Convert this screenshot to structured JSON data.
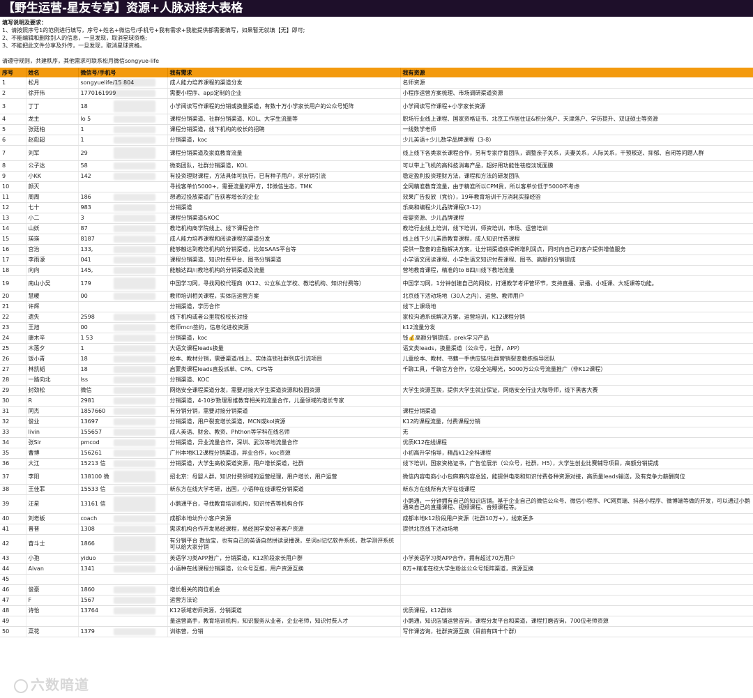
{
  "title": "【野生运营-星友专享】资源+人脉对接大表格",
  "notes": {
    "heading": "填写说明及要求：",
    "lines": [
      "1、请按照序号1的范例进行填写，序号+姓名+微信号/手机号+我有需求+我能提供都需要填写，如果暂无就填【无】即可;",
      "2、不能编辑和删除别人的信息，一旦发现，取消星球资格;",
      "3、不能把此文件分享及外传，一旦发现，取消星球资格。"
    ],
    "footer": "请遵守规则，共建秩序，其他需求可联系松月微信songyue-life"
  },
  "columns": [
    "序号",
    "姓名",
    "微信号/手机号",
    "我有需求",
    "我有资源"
  ],
  "rows": [
    {
      "no": "1",
      "name": "松月",
      "wx": "songyuelife/15 804",
      "need": "成人能力培养课程的渠道分发",
      "have": "名师资源",
      "h": 15
    },
    {
      "no": "2",
      "name": "徐开伟",
      "wx": "1770161999",
      "need": "需要小程序、app定制的企业",
      "have": "小程序运营方案梳理、市场调研渠道资源",
      "h": 15
    },
    {
      "no": "3",
      "name": "丁丁",
      "wx": "18",
      "need": "小学阅读写作课程的分销或换量渠道，有数十万小学家长用户的公众号矩阵",
      "have": "小学阅读写作课程+小学家长资源",
      "h": 22
    },
    {
      "no": "4",
      "name": "龙主",
      "wx": "lo 5",
      "need": "课程分销渠道、社群分销渠道、KOL、大学生流量等",
      "have": "职场行业线上课程、国家资格证书、北京工作居住证&积分落户、天津落户、学历提升、双证硕士等资源",
      "h": 15
    },
    {
      "no": "5",
      "name": "张廷柏",
      "wx": "1",
      "need": "课程分销渠道，线下机构的校长的招聘",
      "have": "一线数学老师",
      "h": 15
    },
    {
      "no": "6",
      "name": "赵彪超",
      "wx": "1",
      "need": "分销渠道，koc",
      "have": "少儿英语+少儿数学品牌课程（3-8）",
      "h": 15
    },
    {
      "no": "7",
      "name": "刘军",
      "wx": "29",
      "need": "课程分销渠道及家庭教育流量",
      "have": "线上线下各类家长课程合作，另有专家疗育团队，调整亲子关系，夫妻关系，人际关系，干预叛逆、抑郁、自闭等问题人群",
      "h": 22
    },
    {
      "no": "8",
      "name": "公子达",
      "wx": "58",
      "need": "微商团队，社群分销渠道，KOL",
      "have": "可以带上飞机的高科技消毒产品，超好用功能性祛痘淡斑面膜",
      "h": 15
    },
    {
      "no": "9",
      "name": "小KK",
      "wx": "142",
      "need": "有投资理财课程，方法具体可执行，已有种子用户，求分销引流",
      "have": "稳定盈利投资理财方法，课程和方法的研发团队",
      "h": 15
    },
    {
      "no": "10",
      "name": "颜灭",
      "wx": "",
      "need": "寻找客单价5000+，需要流量的甲方，非微信生态，TMK",
      "have": "全网精准教育流量，由于精准所以CPM贵，所以客单价低于5000不考虑",
      "h": 15
    },
    {
      "no": "11",
      "name": "周周",
      "wx": "186",
      "need": "想通过投放渠道广告获客增长的企业",
      "have": "效果广告投放（竞价），19年教育培训千万消耗实操经验",
      "h": 15
    },
    {
      "no": "12",
      "name": "七十",
      "wx": "983",
      "need": "分销渠道",
      "have": "乐高和编程少儿品牌课程(3-12)",
      "h": 15
    },
    {
      "no": "13",
      "name": "小二",
      "wx": "3",
      "need": "课程分销渠道&KOC",
      "have": "母婴资源、少儿品牌课程",
      "h": 15
    },
    {
      "no": "14",
      "name": "山妖",
      "wx": "87",
      "need": "教培机构商学院线上、线下课程合作",
      "have": "教培行业线上培训，线下培训，师资培训，市场、运营培训",
      "h": 15
    },
    {
      "no": "15",
      "name": "瑛瑛",
      "wx": "8187",
      "need": "成人能力培养课程和阅读课程的渠道分发",
      "have": "线上线下少儿素质教育课程，成人知识付费课程",
      "h": 15
    },
    {
      "no": "16",
      "name": "宫治",
      "wx": "133,",
      "need": "能够触达到教培机构的分销渠道，比如SAAS平台等",
      "have": "提供一整套的金融解决方案，让分销渠道获得新增利润点，同时向自己的客户提供增值服务",
      "h": 15
    },
    {
      "no": "17",
      "name": "李雨濛",
      "wx": "041",
      "need": "课程分销渠道、知识付费平台、图书分销渠道",
      "have": "小学语文阅读课程、小学生语文知识付费课程、图书、高额的分销提成",
      "h": 15
    },
    {
      "no": "18",
      "name": "向向",
      "wx": "145,",
      "need": "能触达四川教培机构的分销渠道及流量",
      "have": "营地教育课程，精准的to B四川线下教培流量",
      "h": 15
    },
    {
      "no": "19",
      "name": "南山小吴",
      "wx": "179",
      "need": "中国学习网，寻找网校代理商（K12、公立私立学校、教培机构、知识付费等）",
      "have": "中国学习网，1分钟创建自己的网校，打通教学考评管环节，支持直播、录播、小班课、大班课等功能。",
      "h": 22
    },
    {
      "no": "20",
      "name": "慧暖",
      "wx": "00",
      "need": "教师培训相关课程，实体店运营方案",
      "have": "北京线下活动场地（30人之内）、运营、教师用户",
      "h": 15
    },
    {
      "no": "21",
      "name": "许辉",
      "wx": "",
      "need": "分销渠道，学历合作",
      "have": "线下上课场地",
      "h": 15
    },
    {
      "no": "22",
      "name": "遗失",
      "wx": "2598",
      "need": "线下机构或者公里院校校长对接",
      "have": "家校沟通系统解决方案，运营培训，K12课程分销",
      "h": 15
    },
    {
      "no": "23",
      "name": "王旭",
      "wx": "00",
      "need": "老师mcn签约，信息化进校资源",
      "have": "k12流量分发",
      "h": 15
    },
    {
      "no": "24",
      "name": "康木辛",
      "wx": "1 53",
      "need": "分销渠道，koc",
      "have": "钱💰高额分销提成，prek学习产品",
      "h": 15
    },
    {
      "no": "25",
      "name": "木落夕",
      "wx": "1",
      "need": "大语文课程leads换量",
      "have": "语文类leads，换量渠道（公众号，社群，APP）",
      "h": 15
    },
    {
      "no": "26",
      "name": "饭小青",
      "wx": "18",
      "need": "绘本、教材分销，需要渠道/线上、实体连锁社群到店引流项目",
      "have": "儿童绘本、教材、书籍一手供应链/社群营销裂变教练指导团队",
      "h": 15
    },
    {
      "no": "27",
      "name": "林凯韬",
      "wx": "18",
      "need": "启蒙类课程leads直投派单、CPA、CPS等",
      "have": "千聊工具，千聊官方合作，亿级全站曝光，5000万公众号流量推广（非K12课程）",
      "h": 15
    },
    {
      "no": "28",
      "name": "一路向北",
      "wx": "lss",
      "need": "分销渠道、KOC",
      "have": "",
      "h": 15
    },
    {
      "no": "29",
      "name": "封劲松",
      "wx": "微信",
      "need": "网络安全课程渠道分发，需要对接大学生渠道资源和校园资源",
      "have": "大学生资源互换，提供大学生就业保证，网络安全行业大咖导师，线下黑客大赛",
      "h": 15
    },
    {
      "no": "30",
      "name": "R",
      "wx": "2981",
      "need": "分销渠道，4-10岁数理思维教育相关的流量合作，儿童领域的增长专家",
      "have": "",
      "h": 15
    },
    {
      "no": "31",
      "name": "同杰",
      "wx": "1857660",
      "need": "有分销分销，需要对接分销渠道",
      "have": "课程分销渠道",
      "h": 15
    },
    {
      "no": "32",
      "name": "俊业",
      "wx": "13697",
      "need": "分销渠道，用户裂变增长渠道，MCN或kol资源",
      "have": "K12的课程流量，付费课程分销",
      "h": 15
    },
    {
      "no": "33",
      "name": "livin",
      "wx": "155657",
      "need": "成人英语、财会、教资、Phthon等学科在线名师",
      "have": "无",
      "h": 15
    },
    {
      "no": "34",
      "name": "张Sir",
      "wx": "pmcod",
      "need": "分销渠道，异业流量合作，深圳、武汉等地流量合作",
      "have": "优质K12在线课程",
      "h": 15
    },
    {
      "no": "35",
      "name": "曹博",
      "wx": "156261",
      "need": "广州本地K12课程分销渠道，异业合作，koc资源",
      "have": "小初高升学指导，精品k12全科课程",
      "h": 15
    },
    {
      "no": "36",
      "name": "大江",
      "wx": "15213 信",
      "need": "分销渠道，大学生高校渠道资源，用户增长渠道，社群",
      "have": "线下培训，国家资格证书，广告位展示（公众号，社群，H5），大学生创业比赛辅导项目，高额分销提成",
      "h": 15
    },
    {
      "no": "37",
      "name": "李阳",
      "wx": "138100 微",
      "need": "招北京：母婴人群，知识付费领域的运营经理，用户增长，用户运营",
      "have": "微信内容电商小小包麻麻内容总监，能提供电商和知识付费各种资源对接，高质量leads输送，及有竞争力薪酬岗位",
      "h": 22
    },
    {
      "no": "38",
      "name": "王佳菲",
      "wx": "15533 信",
      "need": "新东方在线大学考研，出国，小语种在线课程分销渠道",
      "have": "新东方在线所有大学在线课程",
      "h": 15
    },
    {
      "no": "39",
      "name": "汪星",
      "wx": "13161 信",
      "need": "小鹅通平台，寻找教育培训机构，知识付费等机构合作",
      "have": "小鹅通，一分钟拥有自己的知识店铺。基于企业自己的微信公众号、微信小程序、PC网页端、抖音小程序、微博端等做的开发，可以通过小鹅通来自己的直播课程、视频课程、音频课程等。",
      "h": 27
    },
    {
      "no": "40",
      "name": "刘老板",
      "wx": "coach",
      "need": "成都本地幼升小客户资源",
      "have": "成都本地k12阶段用户资源（社群10万+），线索更多",
      "h": 15
    },
    {
      "no": "41",
      "name": "普普",
      "wx": "1308",
      "need": "需求机构合作开发易经课程，易经国学爱好者客户资源",
      "have": "提供北京线下活动场地",
      "h": 15
    },
    {
      "no": "42",
      "name": "奋斗士",
      "wx": "1866",
      "need": "有分销平台 数益宝，也有自己的英语自然拼读录播课，单词ai记忆软件系统，数学测评系统可以给大家分销",
      "have": "",
      "h": 27
    },
    {
      "no": "43",
      "name": "小孢",
      "wx": "yiduo",
      "need": "英语学习类APP推广，分销渠道，K12阶段家长用户群",
      "have": "小学英语学习类APP合作，拥有超过70万用户",
      "h": 15
    },
    {
      "no": "44",
      "name": "Aivan",
      "wx": "1341",
      "need": "小语种在线课程分销渠道，公众号互推，用户资源互换",
      "have": "8万+精准在校大学生粉丝公众号矩阵渠道，资源互换",
      "h": 15
    },
    {
      "no": "45",
      "name": "",
      "wx": "",
      "need": "",
      "have": "",
      "h": 15
    },
    {
      "no": "46",
      "name": "俊豪",
      "wx": "1860",
      "need": "增长相关的岗位机会",
      "have": "",
      "h": 15
    },
    {
      "no": "47",
      "name": "F",
      "wx": "1567",
      "need": "运营方法论",
      "have": "",
      "h": 15
    },
    {
      "no": "48",
      "name": "诗怡",
      "wx": "13764",
      "need": "K12领域老师资源，分销渠道",
      "have": "优质课程，k12群体",
      "h": 15
    },
    {
      "no": "49",
      "name": "",
      "wx": "",
      "need": "量运营高手，教育培训机构，知识服务从业者，企业老师，知识付费人才",
      "have": "小鹅通，知识店铺运营咨询，课程分发平台和渠道，课程打磨咨询，700位老师资源",
      "h": 15
    },
    {
      "no": "50",
      "name": "菜花",
      "wx": "1379",
      "need": "训练营，分销",
      "have": "写作课咨询，社群资源互换（目前有四十个群）",
      "h": 15
    }
  ],
  "watermark": "六数暗道"
}
